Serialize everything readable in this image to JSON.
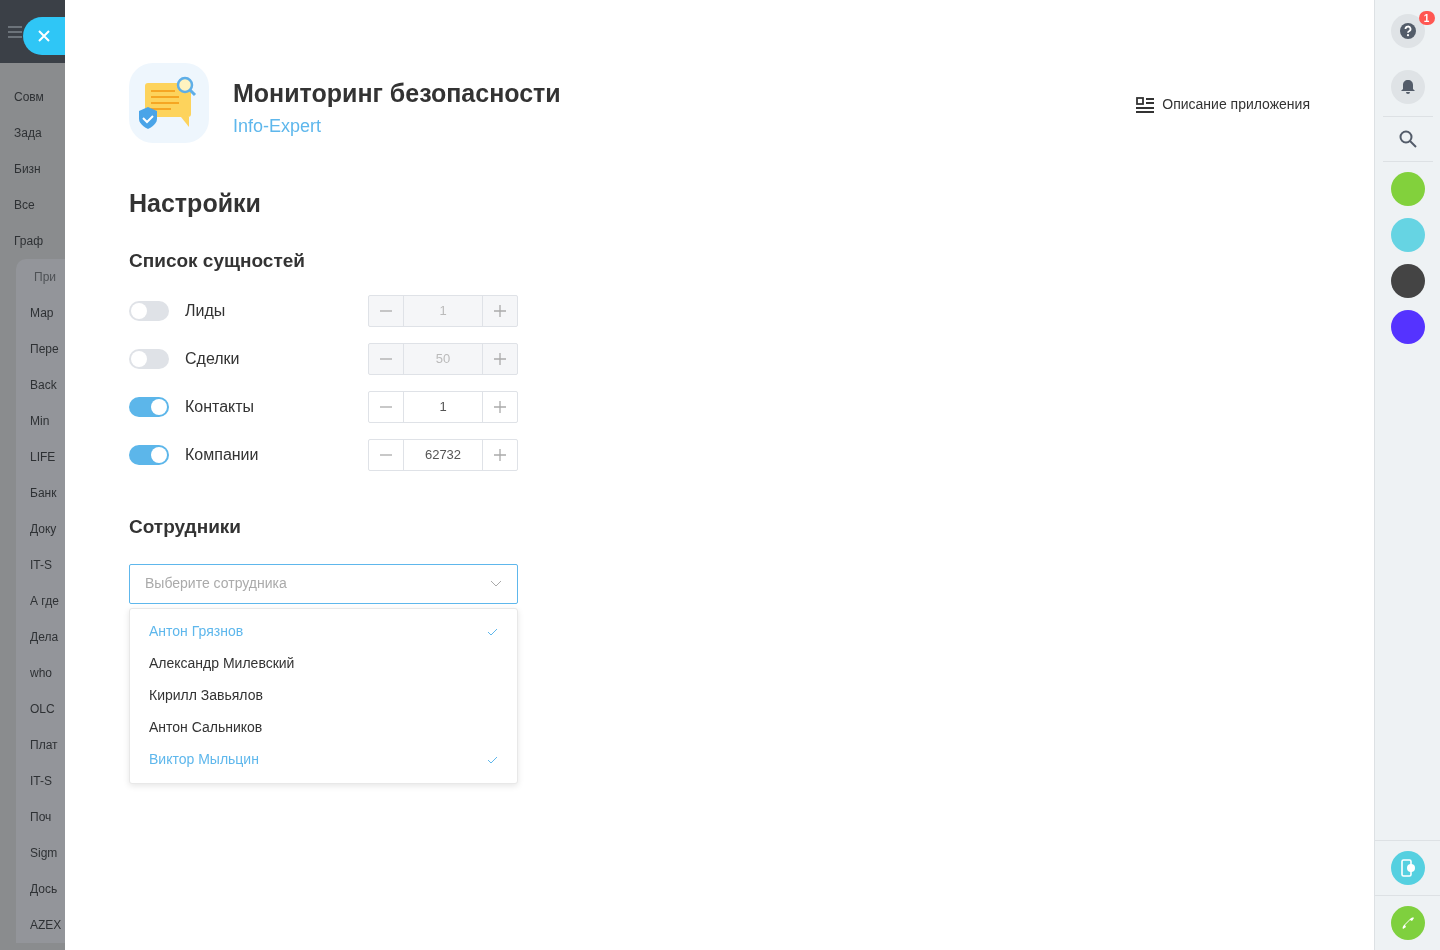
{
  "sidebar": {
    "items": [
      {
        "label": "Совм",
        "kind": "item"
      },
      {
        "label": "Зада",
        "kind": "item"
      },
      {
        "label": "Бизн",
        "kind": "item"
      },
      {
        "label": "Все",
        "kind": "item"
      },
      {
        "label": "Граф",
        "kind": "item"
      },
      {
        "label": "При",
        "kind": "header"
      },
      {
        "label": "Мар",
        "kind": "item"
      },
      {
        "label": "Пере",
        "kind": "item"
      },
      {
        "label": "Back",
        "kind": "item"
      },
      {
        "label": "Min",
        "kind": "item"
      },
      {
        "label": "LIFE",
        "kind": "item"
      },
      {
        "label": "Банк",
        "kind": "item"
      },
      {
        "label": "Доку",
        "kind": "item"
      },
      {
        "label": "IT-S",
        "kind": "item"
      },
      {
        "label": "А где",
        "kind": "item"
      },
      {
        "label": "Дела",
        "kind": "item"
      },
      {
        "label": "who",
        "kind": "item"
      },
      {
        "label": "OLC",
        "kind": "item"
      },
      {
        "label": "Плат",
        "kind": "item"
      },
      {
        "label": "IT-S",
        "kind": "item"
      },
      {
        "label": "Поч",
        "kind": "item"
      },
      {
        "label": "Sigm",
        "kind": "item"
      },
      {
        "label": "Дось",
        "kind": "item"
      },
      {
        "label": "AZEX",
        "kind": "item"
      }
    ]
  },
  "app": {
    "title": "Мониторинг безопасности",
    "vendor": "Info-Expert",
    "description_link": "Описание приложения"
  },
  "settings": {
    "heading": "Настройки",
    "entities_heading": "Список сущностей",
    "entities": [
      {
        "label": "Лиды",
        "on": false,
        "value": "1"
      },
      {
        "label": "Сделки",
        "on": false,
        "value": "50"
      },
      {
        "label": "Контакты",
        "on": true,
        "value": "1"
      },
      {
        "label": "Компании",
        "on": true,
        "value": "62732"
      }
    ],
    "employees_heading": "Сотрудники",
    "employee_select": {
      "placeholder": "Выберите сотрудника",
      "expanded": true,
      "options": [
        {
          "label": "Антон Грязнов",
          "selected": true
        },
        {
          "label": "Александр Милевский",
          "selected": false
        },
        {
          "label": "Кирилл Завьялов",
          "selected": false
        },
        {
          "label": "Антон Сальников",
          "selected": false
        },
        {
          "label": "Виктор Мыльцин",
          "selected": true
        }
      ]
    }
  },
  "right_bar": {
    "help_badge": "1",
    "avatars": [
      {
        "color": "#82d13c"
      },
      {
        "color": "#66d4e3"
      },
      {
        "color": "#444444"
      },
      {
        "color": "#5533ff"
      }
    ]
  }
}
